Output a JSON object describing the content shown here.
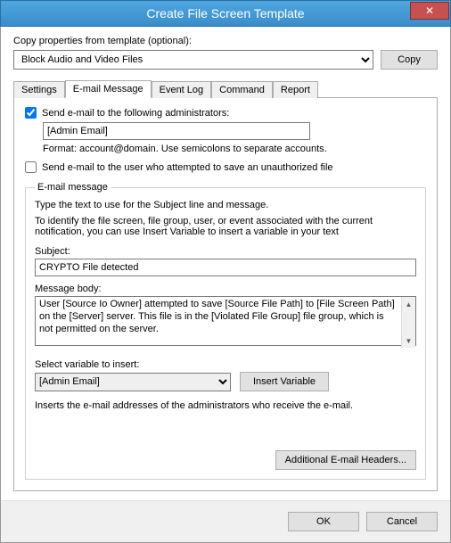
{
  "window": {
    "title": "Create File Screen Template",
    "close_glyph": "✕"
  },
  "copy": {
    "label": "Copy properties from template (optional):",
    "selected": "Block Audio and Video Files",
    "button": "Copy"
  },
  "tabs": {
    "settings": "Settings",
    "email": "E-mail Message",
    "eventlog": "Event Log",
    "command": "Command",
    "report": "Report"
  },
  "email": {
    "chk_admins": "Send e-mail to the following administrators:",
    "to_value": "[Admin Email]",
    "format_help": "Format: account@domain. Use semicolons to separate accounts.",
    "chk_user": "Send e-mail to the user who attempted to save an unauthorized file",
    "group_legend": "E-mail message",
    "intro": "Type the text to use for the Subject line and message.",
    "desc": "To identify the file screen, file group, user, or event associated with the current notification, you can use Insert Variable to insert a variable in your text",
    "subject_label": "Subject:",
    "subject_value": "CRYPTO File detected",
    "body_label": "Message body:",
    "body_value": "User [Source Io Owner] attempted to save [Source File Path] to [File Screen Path] on the [Server] server. This file is in the [Violated File Group] file group, which is not permitted on the server.",
    "var_label": "Select variable to insert:",
    "var_selected": "[Admin Email]",
    "insert_btn": "Insert Variable",
    "var_desc": "Inserts the e-mail addresses of the administrators who receive the e-mail.",
    "headers_btn": "Additional E-mail Headers..."
  },
  "buttons": {
    "ok": "OK",
    "cancel": "Cancel"
  }
}
